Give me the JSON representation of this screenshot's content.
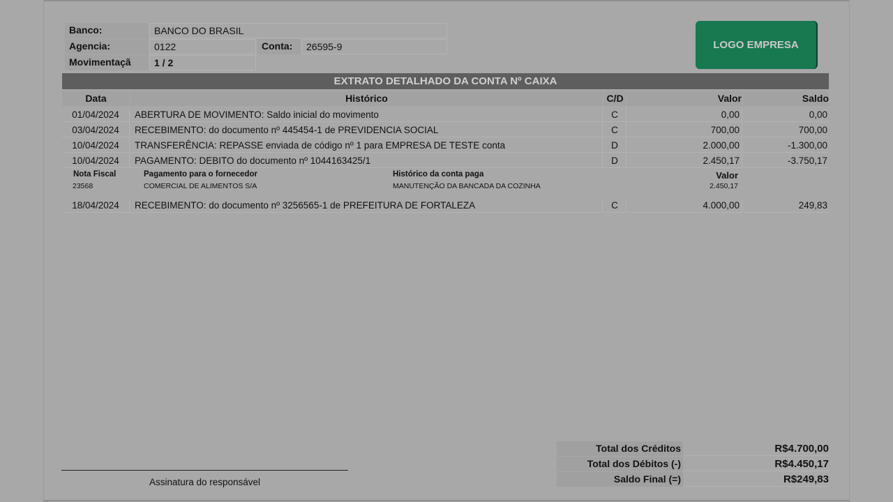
{
  "header": {
    "banco_label": "Banco:",
    "banco_value": "BANCO DO BRASIL",
    "agencia_label": "Agencia:",
    "agencia_value": "0122",
    "conta_label": "Conta:",
    "conta_value": "26595-9",
    "movimentacao_label": "Movimentaçã",
    "movimentacao_value": "1 / 2"
  },
  "logo_text": "LOGO EMPRESA",
  "title": "EXTRATO DETALHADO DA CONTA Nº CAIXA",
  "columns": {
    "data": "Data",
    "historico": "Histórico",
    "cd": "C/D",
    "valor": "Valor",
    "saldo": "Saldo"
  },
  "rows": [
    {
      "data": "01/04/2024",
      "historico": "ABERTURA DE MOVIMENTO: Saldo inicial do movimento",
      "cd": "C",
      "valor": "0,00",
      "saldo": "0,00"
    },
    {
      "data": "03/04/2024",
      "historico": "RECEBIMENTO: do documento nº 445454-1 de PREVIDENCIA SOCIAL",
      "cd": "C",
      "valor": "700,00",
      "saldo": "700,00"
    },
    {
      "data": "10/04/2024",
      "historico": "TRANSFERÊNCIA: REPASSE enviada de código nº 1 para EMPRESA DE TESTE conta",
      "cd": "D",
      "valor": "2.000,00",
      "saldo": "-1.300,00"
    },
    {
      "data": "10/04/2024",
      "historico": "PAGAMENTO: DEBITO do documento nº 1044163425/1",
      "cd": "D",
      "valor": "2.450,17",
      "saldo": "-3.750,17"
    },
    {
      "data": "18/04/2024",
      "historico": "RECEBIMENTO: do documento nº 3256565-1 de PREFEITURA DE FORTALEZA",
      "cd": "C",
      "valor": "4.000,00",
      "saldo": "249,83"
    }
  ],
  "payment_detail": {
    "nota_label": "Nota Fiscal",
    "nota_value": "23568",
    "fornecedor_label": "Pagamento para o fornecedor",
    "fornecedor_value": "COMERCIAL DE ALIMENTOS S/A",
    "historico_label": "Histórico da conta paga",
    "historico_value": "MANUTENÇÃO DA BANCADA DA COZINHA",
    "valor_label": "Valor",
    "valor_value": "2.450,17"
  },
  "totals": {
    "creditos_label": "Total dos Créditos",
    "creditos_value": "R$4.700,00",
    "debitos_label": "Total dos Débitos (-)",
    "debitos_value": "R$4.450,17",
    "saldo_label": "Saldo Final (=)",
    "saldo_value": "R$249,83"
  },
  "signature_label": "Assinatura do responsável"
}
